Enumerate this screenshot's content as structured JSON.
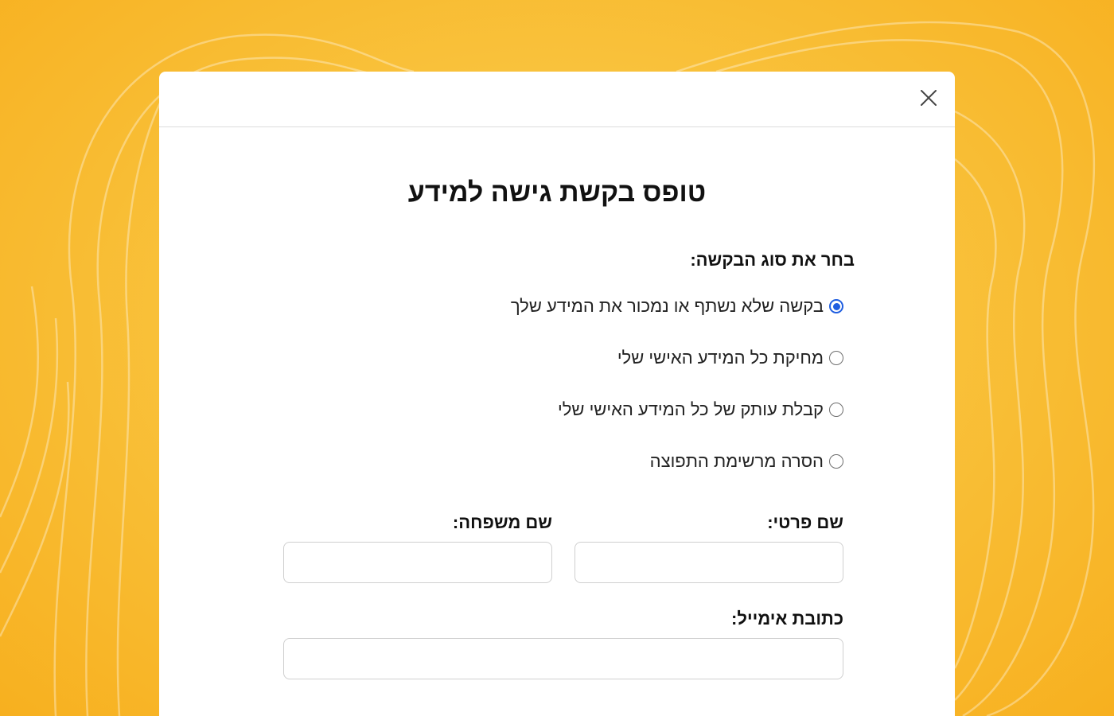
{
  "form": {
    "title": "טופס בקשת גישה למידע",
    "request_type_label": "בחר את סוג הבקשה:",
    "options": [
      {
        "label": "בקשה שלא נשתף או נמכור את המידע שלך",
        "selected": true
      },
      {
        "label": "מחיקת כל המידע האישי שלי",
        "selected": false
      },
      {
        "label": "קבלת עותק של כל המידע האישי שלי",
        "selected": false
      },
      {
        "label": "הסרה מרשימת התפוצה",
        "selected": false
      }
    ],
    "first_name_label": "שם פרטי:",
    "last_name_label": "שם משפחה:",
    "email_label": "כתובת אימייל:",
    "first_name_value": "",
    "last_name_value": "",
    "email_value": ""
  },
  "icons": {
    "close": "close-icon"
  },
  "colors": {
    "background": "#f9c23c",
    "accent": "#1f5ee0",
    "modal": "#ffffff"
  }
}
